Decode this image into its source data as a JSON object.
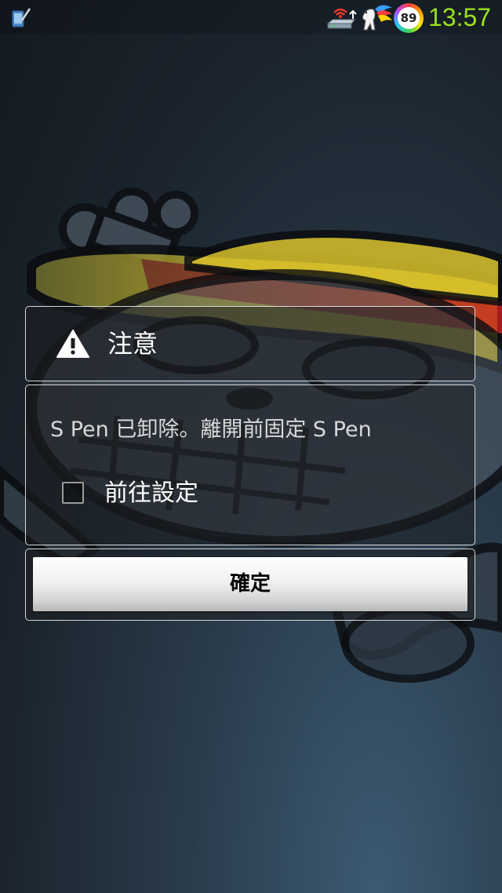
{
  "status_bar": {
    "battery_level": "89",
    "time": "13:57",
    "icons": [
      "tablet-pen-icon",
      "wifi-router-icon",
      "rainbow-pony-icon",
      "battery-ring-icon"
    ]
  },
  "dialog": {
    "icon": "warning-icon",
    "title": "注意",
    "message": "S Pen 已卸除。離開前固定 S Pen",
    "checkbox": {
      "label": "前往設定",
      "checked": false
    },
    "ok_label": "確定"
  },
  "colors": {
    "time": "#9be11a",
    "dialog_border": "#ebebeb",
    "button_face": "#f1f1f1"
  }
}
